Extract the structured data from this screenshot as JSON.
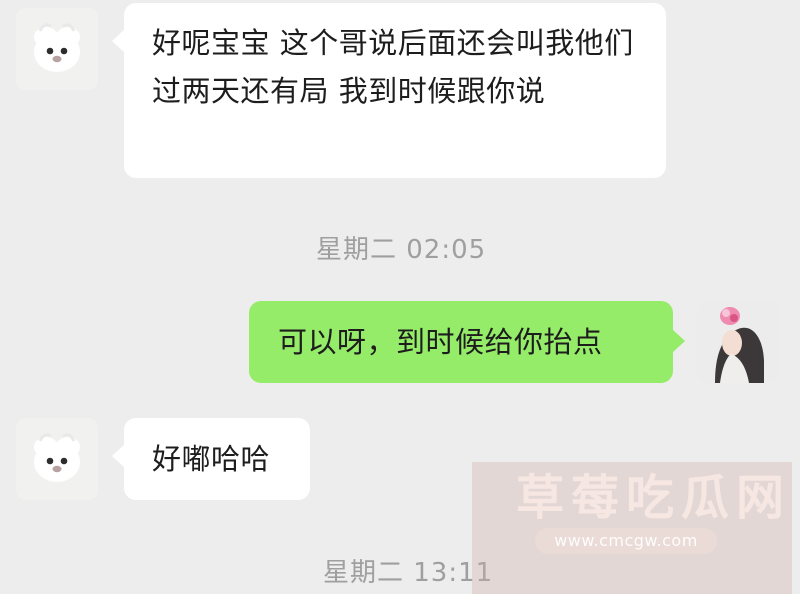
{
  "messages": [
    {
      "text": "好呢宝宝 这个哥说后面还会叫我他们过两天还有局 我到时候跟你说"
    },
    {
      "text": "可以呀，到时候给你抬点"
    },
    {
      "text": "好嘟哈哈"
    }
  ],
  "timestamps": [
    "星期二 02:05",
    "星期二 13:11"
  ],
  "watermark": {
    "title": "草莓吃瓜网",
    "url": "www.cmcgw.com"
  },
  "colors": {
    "background": "#ededed",
    "incoming_bubble": "#ffffff",
    "outgoing_bubble": "#95ec69",
    "timestamp_text": "#9f9f9f"
  },
  "icons": {
    "contact_avatar": "dog-avatar-icon",
    "user_avatar": "girl-photo-avatar"
  }
}
